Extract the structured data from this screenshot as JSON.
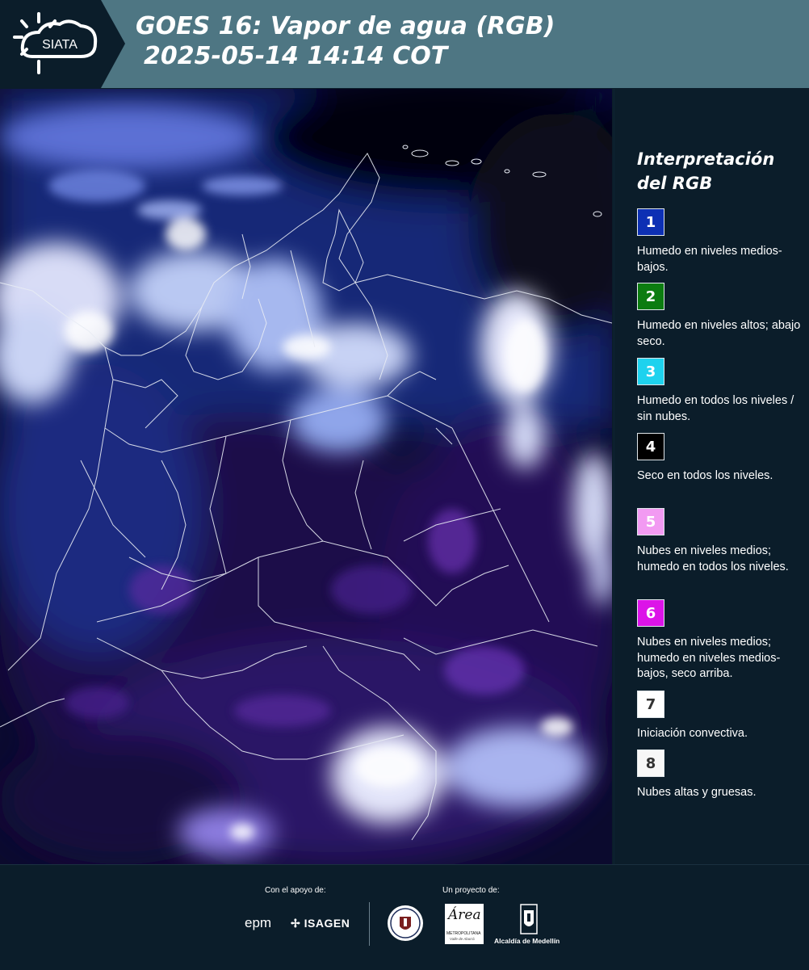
{
  "header": {
    "logo_text": "SIATA",
    "title_line1": "GOES 16: Vapor de agua (RGB)",
    "title_line2": "2025-05-14 14:14 COT",
    "background": "#4e7683"
  },
  "legend": {
    "title_line1": "Interpretación",
    "title_line2": "del RGB",
    "items": [
      {
        "num": "1",
        "color": "#0d30b4",
        "text_color": "#ffffff",
        "label": "Humedo en niveles medios-bajos."
      },
      {
        "num": "2",
        "color": "#0c7c10",
        "text_color": "#ffffff",
        "label": "Humedo en niveles altos; abajo seco."
      },
      {
        "num": "3",
        "color": "#1ed2ee",
        "text_color": "#ffffff",
        "label": "Humedo en todos los niveles / sin nubes."
      },
      {
        "num": "4",
        "color": "#000000",
        "text_color": "#ffffff",
        "label": "Seco en todos los niveles."
      },
      {
        "num": "5",
        "color": "#f29af2",
        "text_color": "#ffffff",
        "label": "Nubes en niveles medios; humedo en todos los niveles."
      },
      {
        "num": "6",
        "color": "#dc14e8",
        "text_color": "#ffffff",
        "label": "Nubes en niveles medios; humedo en niveles medios-bajos, seco arriba."
      },
      {
        "num": "7",
        "color": "#ffffff",
        "text_color": "#333333",
        "label": "Iniciación convectiva."
      },
      {
        "num": "8",
        "color": "#f7f7f7",
        "text_color": "#333333",
        "label": "Nubes altas y gruesas."
      }
    ]
  },
  "footer": {
    "support_label": "Con el apoyo de:",
    "project_label": "Un proyecto de:",
    "epm": "epm",
    "isagen": "ISAGEN",
    "area_name": "Área",
    "area_sub": "METROPOLITANA",
    "area_sub2": "Valle de Aburrá",
    "alcaldia": "Alcaldía de Medellín"
  }
}
